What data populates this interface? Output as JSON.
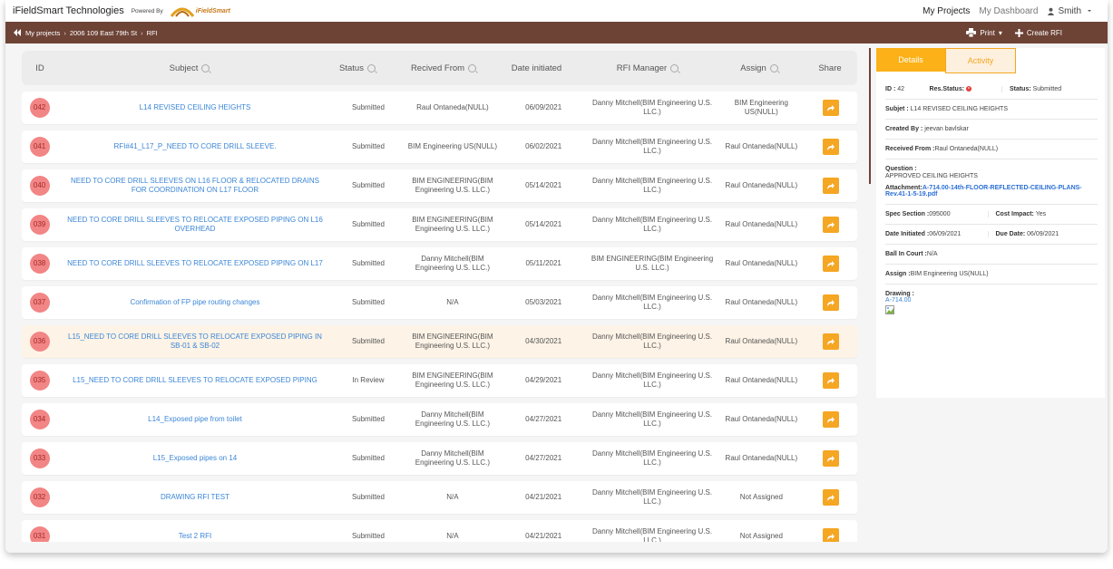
{
  "topbar": {
    "brand": "iFieldSmart Technologies",
    "powered_by": "Powered By",
    "logo_text": "iFieldSmart",
    "nav": {
      "my_projects": "My Projects",
      "my_dashboard": "My Dashboard",
      "user": "Smith"
    }
  },
  "navbar": {
    "breadcrumb": [
      "My projects",
      "2006 109 East 79th St",
      "RFI"
    ],
    "print": "Print",
    "create": "Create RFI"
  },
  "table": {
    "headers": {
      "id": "ID",
      "subject": "Subject",
      "status": "Status",
      "received_from": "Recived From",
      "date": "Date initiated",
      "manager": "RFI Manager",
      "assign": "Assign",
      "share": "Share"
    },
    "rows": [
      {
        "id": "042",
        "subject": "L14 REVISED CEILING HEIGHTS",
        "status": "Submitted",
        "from": "Raul Ontaneda(NULL)",
        "date": "06/09/2021",
        "manager": "Danny Mitchell(BIM Engineering U.S. LLC.)",
        "assign": "BIM Engineering US(NULL)"
      },
      {
        "id": "041",
        "subject": "RFI#41_L17_P_NEED TO CORE DRILL SLEEVE.",
        "status": "Submitted",
        "from": "BIM Engineering US(NULL)",
        "date": "06/02/2021",
        "manager": "Danny Mitchell(BIM Engineering U.S. LLC.)",
        "assign": "Raul Ontaneda(NULL)"
      },
      {
        "id": "040",
        "subject": "NEED TO CORE DRILL SLEEVES ON L16 FLOOR & RELOCATED DRAINS FOR COORDINATION ON L17 FLOOR",
        "status": "Submitted",
        "from": "BIM ENGINEERING(BIM Engineering U.S. LLC.)",
        "date": "05/14/2021",
        "manager": "Danny Mitchell(BIM Engineering U.S. LLC.)",
        "assign": "Raul Ontaneda(NULL)"
      },
      {
        "id": "039",
        "subject": "NEED TO CORE DRILL SLEEVES TO RELOCATE EXPOSED PIPING ON L16 OVERHEAD",
        "status": "Submitted",
        "from": "BIM ENGINEERING(BIM Engineering U.S. LLC.)",
        "date": "05/14/2021",
        "manager": "Danny Mitchell(BIM Engineering U.S. LLC.)",
        "assign": "Raul Ontaneda(NULL)"
      },
      {
        "id": "038",
        "subject": "NEED TO CORE DRILL SLEEVES TO RELOCATE EXPOSED PIPING ON L17",
        "status": "Submitted",
        "from": "Danny Mitchell(BIM Engineering U.S. LLC.)",
        "date": "05/11/2021",
        "manager": "BIM ENGINEERING(BIM Engineering U.S. LLC.)",
        "assign": "Raul Ontaneda(NULL)"
      },
      {
        "id": "037",
        "subject": "Confirmation of FP pipe routing changes",
        "status": "Submitted",
        "from": "N/A",
        "date": "05/03/2021",
        "manager": "Danny Mitchell(BIM Engineering U.S. LLC.)",
        "assign": "Raul Ontaneda(NULL)"
      },
      {
        "id": "036",
        "subject": "L15_NEED TO CORE DRILL SLEEVES TO RELOCATE EXPOSED PIPING IN SB-01 & SB-02",
        "status": "Submitted",
        "from": "BIM ENGINEERING(BIM Engineering U.S. LLC.)",
        "date": "04/30/2021",
        "manager": "Danny Mitchell(BIM Engineering U.S. LLC.)",
        "assign": "Raul Ontaneda(NULL)"
      },
      {
        "id": "035",
        "subject": "L15_NEED TO CORE DRILL SLEEVES TO RELOCATE EXPOSED PIPING",
        "status": "In Review",
        "from": "BIM ENGINEERING(BIM Engineering U.S. LLC.)",
        "date": "04/29/2021",
        "manager": "Danny Mitchell(BIM Engineering U.S. LLC.)",
        "assign": "Raul Ontaneda(NULL)"
      },
      {
        "id": "034",
        "subject": "L14_Exposed pipe from toilet",
        "status": "Submitted",
        "from": "Danny Mitchell(BIM Engineering U.S. LLC.)",
        "date": "04/27/2021",
        "manager": "Danny Mitchell(BIM Engineering U.S. LLC.)",
        "assign": "Raul Ontaneda(NULL)"
      },
      {
        "id": "033",
        "subject": "L15_Exposed pipes on 14",
        "status": "Submitted",
        "from": "Danny Mitchell(BIM Engineering U.S. LLC.)",
        "date": "04/27/2021",
        "manager": "Danny Mitchell(BIM Engineering U.S. LLC.)",
        "assign": "Raul Ontaneda(NULL)"
      },
      {
        "id": "032",
        "subject": "DRAWING RFI TEST",
        "status": "Submitted",
        "from": "N/A",
        "date": "04/21/2021",
        "manager": "Danny Mitchell(BIM Engineering U.S. LLC.)",
        "assign": "Not Assigned"
      },
      {
        "id": "031",
        "subject": "Test 2 RFI",
        "status": "Submitted",
        "from": "N/A",
        "date": "04/21/2021",
        "manager": "Danny Mitchell(BIM Engineering U.S. LLC.)",
        "assign": "Not Assigned"
      }
    ]
  },
  "details": {
    "tabs": [
      "Details",
      "Activity"
    ],
    "id_label": "ID :",
    "id_value": "42",
    "res_status_label": "Res.Status:",
    "status_label": "Status:",
    "status_value": "Submitted",
    "subject_label": "Subjet :",
    "subject_value": "L14 REVISED CEILING HEIGHTS",
    "created_label": "Created By :",
    "created_value": "jeevan bavlskar",
    "received_label": "Received From :",
    "received_value": "Raul Ontaneda(NULL)",
    "question_label": "Question :",
    "question_value": "APPROVED CEILING HEIGHTS",
    "attachment_label": "Attachment:",
    "attachment_value": "A-714.00-14th-FLOOR-REFLECTED-CEILING-PLANS-Rev.41-1-5-19.pdf",
    "spec_label": "Spec Section :",
    "spec_value": "095000",
    "cost_label": "Cost Impact:",
    "cost_value": "Yes",
    "date_init_label": "Date Initiated :",
    "date_init_value": "06/09/2021",
    "due_label": "Due Date:",
    "due_value": "06/09/2021",
    "ball_label": "Ball In Court :",
    "ball_value": "N/A",
    "assign_label": "Assign :",
    "assign_value": "BIM Engineering US(NULL)",
    "drawing_label": "Drawing :",
    "drawing_value": "A-714.00"
  },
  "colors": {
    "brown": "#6d4336",
    "orange": "#f5a623",
    "id_badge": "#f28585",
    "link": "#3b86d6"
  }
}
